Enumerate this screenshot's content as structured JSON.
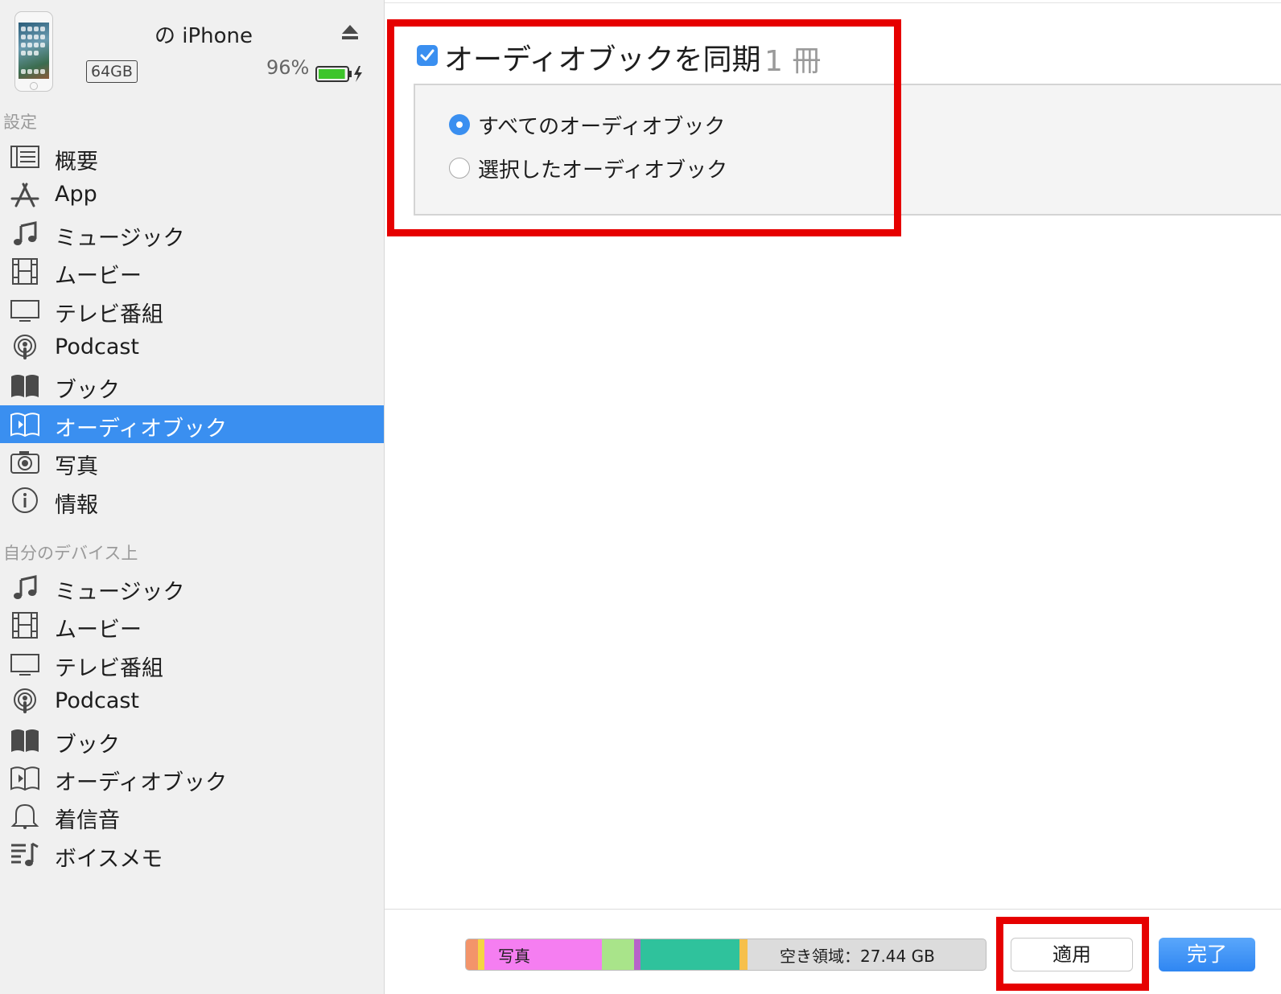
{
  "device": {
    "name": "の iPhone",
    "capacity": "64GB",
    "battery_percent": "96%",
    "battery_level": 0.96,
    "battery_color": "#3dc52b"
  },
  "sidebar": {
    "settings_heading": "設定",
    "settings_items": [
      {
        "label": "概要",
        "icon": "summary-list-icon"
      },
      {
        "label": "App",
        "icon": "app-store-icon"
      },
      {
        "label": "ミュージック",
        "icon": "music-note-icon"
      },
      {
        "label": "ムービー",
        "icon": "film-strip-icon"
      },
      {
        "label": "テレビ番組",
        "icon": "tv-monitor-icon"
      },
      {
        "label": "Podcast",
        "icon": "podcast-icon"
      },
      {
        "label": "ブック",
        "icon": "book-icon"
      },
      {
        "label": "オーディオブック",
        "icon": "audiobook-icon",
        "selected": true
      },
      {
        "label": "写真",
        "icon": "camera-icon"
      },
      {
        "label": "情報",
        "icon": "info-icon"
      }
    ],
    "on_device_heading": "自分のデバイス上",
    "device_items": [
      {
        "label": "ミュージック",
        "icon": "music-note-icon"
      },
      {
        "label": "ムービー",
        "icon": "film-strip-icon"
      },
      {
        "label": "テレビ番組",
        "icon": "tv-monitor-icon"
      },
      {
        "label": "Podcast",
        "icon": "podcast-icon"
      },
      {
        "label": "ブック",
        "icon": "book-icon"
      },
      {
        "label": "オーディオブック",
        "icon": "audiobook-icon"
      },
      {
        "label": "着信音",
        "icon": "bell-icon"
      },
      {
        "label": "ボイスメモ",
        "icon": "voice-memo-icon"
      }
    ]
  },
  "main": {
    "sync_label": "オーディオブックを同期",
    "sync_count": "1 冊",
    "sync_checked": true,
    "options": [
      {
        "label": "すべてのオーディオブック",
        "selected": true
      },
      {
        "label": "選択したオーディオブック",
        "selected": false
      }
    ]
  },
  "footer": {
    "storage_photo_label": "写真",
    "storage_free_label": "空き領域：27.44 GB",
    "storage_segments": [
      {
        "name": "other-a",
        "color": "#f3946a"
      },
      {
        "name": "other-b",
        "color": "#f6d443"
      },
      {
        "name": "photos",
        "color": "#f57ef1"
      },
      {
        "name": "apps-a",
        "color": "#a9e48a"
      },
      {
        "name": "apps-b",
        "color": "#b763c9"
      },
      {
        "name": "apps-c",
        "color": "#2fc29c"
      },
      {
        "name": "other-c",
        "color": "#f6c04b"
      }
    ],
    "apply_label": "適用",
    "done_label": "完了"
  },
  "colors": {
    "accent": "#3a8ff0",
    "highlight_red": "#e60000",
    "sidebar_bg": "#f0f0f0"
  }
}
